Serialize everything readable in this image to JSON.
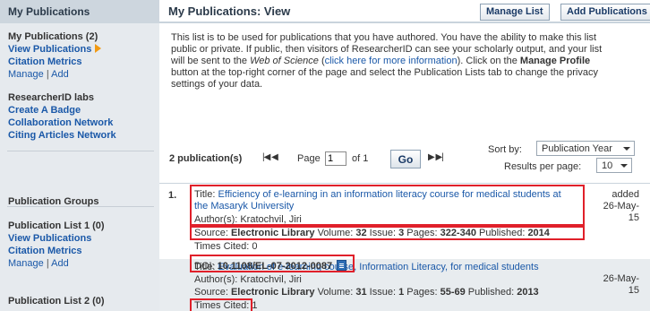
{
  "sidebar": {
    "header": "My Publications",
    "my_pubs_title": "My Publications (2)",
    "view_publications": "View Publications",
    "citation_metrics": "Citation Metrics",
    "manage": "Manage",
    "add": "Add",
    "separator": "|",
    "labs_title": "ResearcherID labs",
    "create_badge": "Create A Badge",
    "collab_network": "Collaboration Network",
    "citing_network": "Citing Articles Network",
    "groups_title": "Publication Groups",
    "list1_title": "Publication List 1 (0)",
    "list1_view": "View Publications",
    "list1_metrics": "Citation Metrics",
    "list1_manage": "Manage",
    "list1_add": "Add",
    "list2_title": "Publication List 2 (0)"
  },
  "main": {
    "title": "My Publications: View",
    "manage_list_btn": "Manage List",
    "add_publications_btn": "Add Publications",
    "desc_line1": "This list is to be used for publications that you have authored. You have the ability to make this list",
    "desc_line2": "public or private. If public, then visitors of ResearcherID can see your scholarly output, and your list",
    "desc_line3_a": "will be sent to the ",
    "desc_line3_b": "Web of Science",
    "desc_line3_c": " (",
    "desc_line3_link": "click here for more information",
    "desc_line3_d": "). Click on the ",
    "desc_line3_e": "Manage Profile",
    "desc_line4": "button at the top-right corner of the page and select the Publication Lists tab to change the privacy",
    "desc_line5": "settings of your data."
  },
  "pager": {
    "count": "2 publication(s)",
    "first_prev": "|◀ ◀",
    "page_label": "Page",
    "page_value": "1",
    "of_label": "of 1",
    "go": "Go",
    "next_last": "▶ ▶|",
    "sort_label": "Sort by:",
    "sort_value": "Publication Year",
    "rpp_label": "Results per page:",
    "rpp_value": "10"
  },
  "records": [
    {
      "num": "1.",
      "title_label": "Title: ",
      "title_part1": "Efficiency of e-learning in an information literacy course for medical students at",
      "title_part2": "the Masaryk University",
      "authors": "Author(s): Kratochvil, Jiri",
      "source_label": "Source: ",
      "source_journal": "Electronic Library",
      "source_vol_label": " Volume: ",
      "source_vol": "32",
      "source_issue_label": " Issue: ",
      "source_issue": "3",
      "source_pages_label": " Pages: ",
      "source_pages": "322-340",
      "source_pub_label": " Published: ",
      "source_pub": "2014",
      "times_cited": "Times Cited: 0",
      "doi_label": "DOI: ",
      "doi": "10.1108/EL-07-2012-0087",
      "added_label": "added",
      "added_date": "26-May-15"
    },
    {
      "num": "2.",
      "title_label": "Title: ",
      "title_part1": "Evaluation of e-learning course, Information Literacy, for medical students",
      "authors": "Author(s): Kratochvil, Jiri",
      "source_label": "Source: ",
      "source_journal": "Electronic Library",
      "source_vol_label": " Volume: ",
      "source_vol": "31",
      "source_issue_label": " Issue: ",
      "source_issue": "1",
      "source_pages_label": " Pages: ",
      "source_pages": "55-69",
      "source_pub_label": " Published: ",
      "source_pub": "2013",
      "times_cited": "Times Cited: 1",
      "added_label": "added",
      "added_date": "26-May-15"
    }
  ]
}
